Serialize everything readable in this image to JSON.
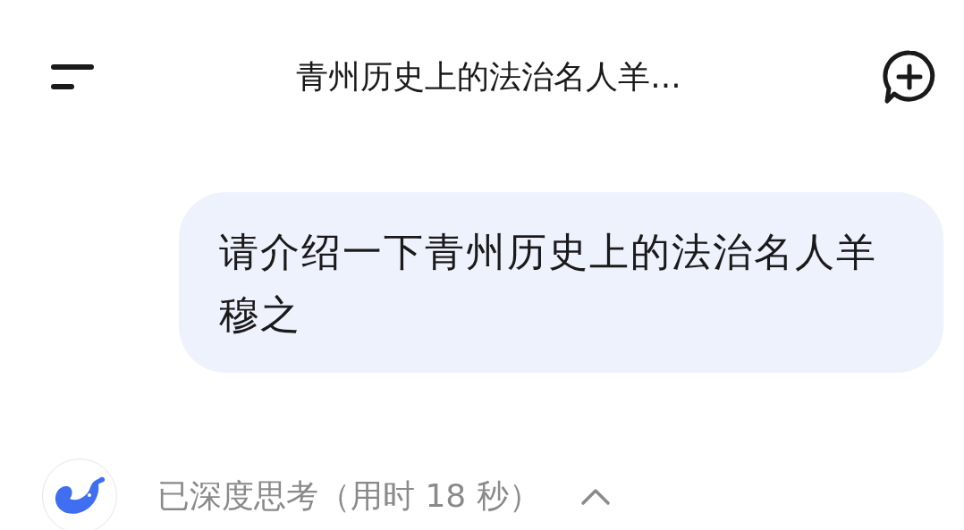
{
  "header": {
    "title": "青州历史上的法治名人羊..."
  },
  "messages": [
    {
      "kind": "user",
      "text": "请介绍一下青州历史上的法治名人羊穆之"
    }
  ],
  "thinking": {
    "label": "已深度思考（用时 18 秒）",
    "expanded": true
  }
}
